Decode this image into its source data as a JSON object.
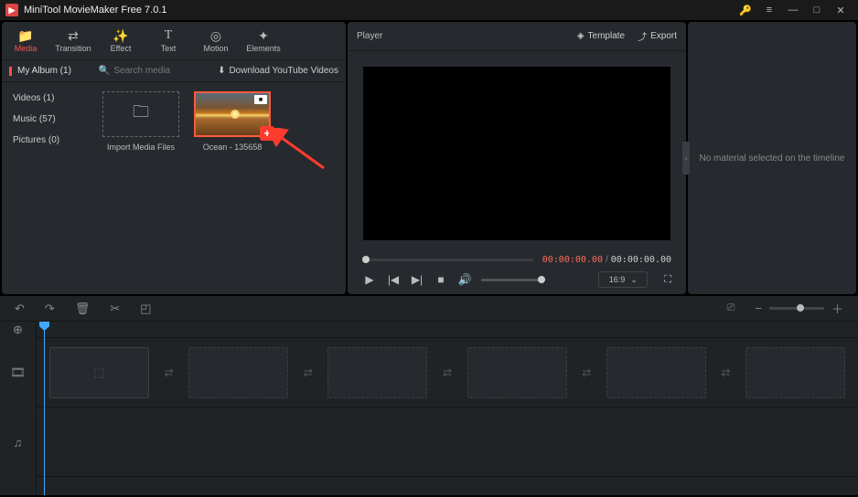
{
  "app": {
    "title": "MiniTool MovieMaker Free 7.0.1"
  },
  "toolbar": {
    "tabs": [
      {
        "icon": "📁",
        "label": "Media"
      },
      {
        "icon": "⇄",
        "label": "Transition"
      },
      {
        "icon": "✨",
        "label": "Effect"
      },
      {
        "icon": "T",
        "label": "Text"
      },
      {
        "icon": "◎",
        "label": "Motion"
      },
      {
        "icon": "✦",
        "label": "Elements"
      }
    ]
  },
  "album": {
    "name": "My Album (1)",
    "search_placeholder": "Search media",
    "download": "Download YouTube Videos"
  },
  "media_side": [
    {
      "label": "Videos (1)"
    },
    {
      "label": "Music (57)"
    },
    {
      "label": "Pictures (0)"
    }
  ],
  "media_items": {
    "import_label": "Import Media Files",
    "clip1_label": "Ocean - 135658"
  },
  "player": {
    "label": "Player",
    "template": "Template",
    "export": "Export",
    "time_current": "00:00:00.00",
    "time_total": "00:00:00.00",
    "aspect": "16:9"
  },
  "right_panel": {
    "message": "No material selected on the timeline"
  }
}
